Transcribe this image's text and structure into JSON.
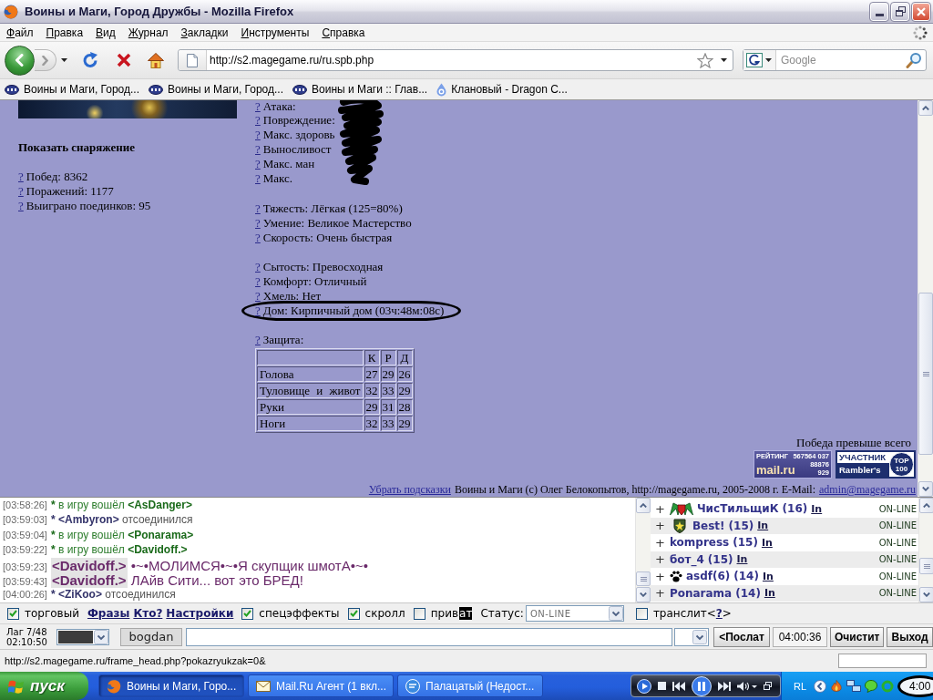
{
  "window": {
    "title": "Воины и Маги, Город Дружбы - Mozilla Firefox"
  },
  "menu": [
    "Файл",
    "Правка",
    "Вид",
    "Журнал",
    "Закладки",
    "Инструменты",
    "Справка"
  ],
  "navigation": {
    "url": "http://s2.magegame.ru/ru.spb.php",
    "search": {
      "placeholder": "Google"
    }
  },
  "bookmarks": [
    {
      "kind": "php",
      "label": "Воины и Маги, Город..."
    },
    {
      "kind": "php",
      "label": "Воины и Маги, Город..."
    },
    {
      "kind": "php",
      "label": "Воины и Маги :: Глав..."
    },
    {
      "kind": "clan",
      "label": "Клановый - Dragon C..."
    }
  ],
  "profile": {
    "equipment_link": "Показать снаряжение",
    "record": [
      {
        "help": "?",
        "text": "Побед: 8362"
      },
      {
        "help": "?",
        "text": "Поражений: 1177"
      },
      {
        "help": "?",
        "text": "Выиграно поединков: 95"
      }
    ]
  },
  "character_stats": {
    "groups": [
      {
        "scribbled": true,
        "lines": [
          {
            "help": "?",
            "text": "Атака:",
            "circled": false
          },
          {
            "help": "?",
            "text": "Повреждение:",
            "circled": false
          },
          {
            "help": "?",
            "text": "Макс. здоровь",
            "circled": false
          },
          {
            "help": "?",
            "text": "Выносливост",
            "circled": false
          },
          {
            "help": "?",
            "text": "Макс. ман",
            "circled": false
          },
          {
            "help": "?",
            "text": "Макс.",
            "circled": false
          }
        ]
      },
      {
        "scribbled": false,
        "lines": [
          {
            "help": "?",
            "text": "Тяжесть: Лёгкая (125=80%)",
            "circled": false
          },
          {
            "help": "?",
            "text": "Умение: Великое Мастерство",
            "circled": false
          },
          {
            "help": "?",
            "text": "Скорость: Очень быстрая",
            "circled": false
          }
        ]
      },
      {
        "scribbled": false,
        "lines": [
          {
            "help": "?",
            "text": "Сытость: Превосходная",
            "circled": false
          },
          {
            "help": "?",
            "text": "Комфорт: Отличный",
            "circled": false
          },
          {
            "help": "?",
            "text": "Хмель: Нет",
            "circled": false
          },
          {
            "help": "?",
            "text": "Дом: Кирпичный дом (03ч:48м:08с)",
            "circled": true
          }
        ]
      }
    ]
  },
  "defense": {
    "help": "?",
    "label": "Защита:",
    "columns": [
      "К",
      "Р",
      "Д"
    ],
    "rows": [
      {
        "part": "Голова",
        "values": [
          "27",
          "29",
          "26"
        ]
      },
      {
        "part": "Туловище и живот",
        "values": [
          "32",
          "33",
          "29"
        ]
      },
      {
        "part": "Руки",
        "values": [
          "29",
          "31",
          "28"
        ]
      },
      {
        "part": "Ноги",
        "values": [
          "32",
          "33",
          "29"
        ]
      }
    ]
  },
  "motto": "Победа превыше всего",
  "counters": [
    {
      "kind": "mail-rating",
      "title": "РЕЙТИНГ",
      "number": "567564 037",
      "logo": "mail.ru",
      "hits": "88876",
      "hosts": "929"
    },
    {
      "kind": "rambler-top",
      "title": "УЧАСТНИК",
      "logo": "Rambler's",
      "top": "TOP",
      "rank": "100"
    }
  ],
  "footer": {
    "hide_hints": "Убрать подсказки",
    "copyright": "Воины и Маги (c) Олег Белокопытов, http://magegame.ru, 2005-2008 г. E-Mail:",
    "email": "admin@magegame.ru"
  },
  "chat": {
    "messages": [
      {
        "time": "[03:58:26]",
        "kind": "join",
        "marker": "*",
        "text": "в игру вошёл",
        "nick": "<AsDanger>"
      },
      {
        "time": "[03:59:03]",
        "kind": "leave",
        "marker": "*",
        "nick": "<Ambyron>",
        "text": "отсоединился"
      },
      {
        "time": "[03:59:04]",
        "kind": "join",
        "marker": "*",
        "text": "в игру вошёл",
        "nick": "<Ponarama>"
      },
      {
        "time": "[03:59:22]",
        "kind": "join",
        "marker": "*",
        "text": "в игру вошёл",
        "nick": "<Davidoff.>"
      },
      {
        "time": "[03:59:23]",
        "kind": "say",
        "nick": "<Davidoff.>",
        "text": "•~•МОЛИМСЯ•~•Я скупщик шмотА•~•"
      },
      {
        "time": "[03:59:43]",
        "kind": "say",
        "nick": "<Davidoff.>",
        "text": "ЛАйв Сити... вот это БРЕД!"
      },
      {
        "time": "[04:00:26]",
        "kind": "leave",
        "marker": "*",
        "nick": "<ZiKoo>",
        "text": "отсоединился"
      }
    ]
  },
  "online": {
    "players": [
      {
        "kind": "wings",
        "expand": "+",
        "name": "ЧисТильщиК",
        "rank": "(16)",
        "info": "In",
        "status": "ON-LINE"
      },
      {
        "kind": "shield",
        "expand": "+",
        "name": "Best!",
        "rank": "(15)",
        "info": "In",
        "status": "ON-LINE"
      },
      {
        "kind": "plain",
        "expand": "+",
        "name": "kompress",
        "rank": "(15)",
        "info": "In",
        "status": "ON-LINE"
      },
      {
        "kind": "plain",
        "expand": "+",
        "name": "бот_4",
        "rank": "(15)",
        "info": "In",
        "status": "ON-LINE"
      },
      {
        "kind": "paw",
        "expand": "+",
        "name": "asdf(6)",
        "rank": "(14)",
        "info": "In",
        "status": "ON-LINE"
      },
      {
        "kind": "plain",
        "expand": "+",
        "name": "Ponarama",
        "rank": "(14)",
        "info": "In",
        "status": "ON-LINE"
      }
    ]
  },
  "chat_controls": [
    {
      "kind": "checkbox",
      "checked": true,
      "label": "торговый"
    },
    {
      "kind": "link",
      "label": "Фразы"
    },
    {
      "kind": "link",
      "label": "Кто?"
    },
    {
      "kind": "link",
      "label": "Настройки"
    },
    {
      "kind": "checkbox",
      "checked": true,
      "label": "спецэффекты"
    },
    {
      "kind": "checkbox",
      "checked": true,
      "label": "скролл"
    },
    {
      "kind": "checkbox",
      "checked": false,
      "label": "прив",
      "highlighted_text": "ат"
    },
    {
      "kind": "select",
      "label": "Статус:",
      "value": "ON-LINE"
    },
    {
      "kind": "checkbox",
      "checked": false,
      "label": "транслит<",
      "help": "?",
      "tail": ">"
    }
  ],
  "message_bar": {
    "lag": "Лаг 7/48",
    "uptime": "02:10:50",
    "recipient": "bogdan",
    "send_button": "<Послат",
    "time": "04:00:36",
    "clear_button": "Очистит",
    "exit_button": "Выход"
  },
  "status_bar": {
    "text": "http://s2.magegame.ru/frame_head.php?pokazryukzak=0&"
  },
  "taskbar": {
    "start": "пуск",
    "tasks": [
      {
        "kind": "browser",
        "label": "Воины и Маги, Горо...",
        "selected": true
      },
      {
        "kind": "mail",
        "label": "Mail.Ru Агент (1 вкл...",
        "selected": false
      },
      {
        "kind": "messenger",
        "label": "Палацатый (Недост...",
        "selected": false
      }
    ],
    "tray": {
      "label": "RL",
      "clock": "4:00",
      "circled": true
    }
  }
}
